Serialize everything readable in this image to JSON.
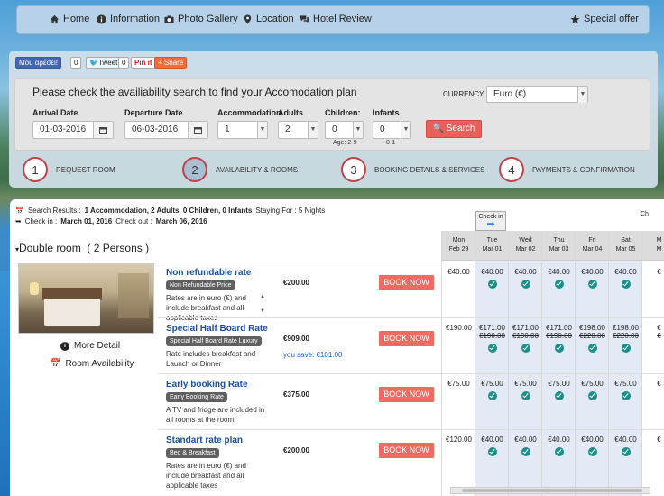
{
  "nav": {
    "home": "Home",
    "information": "Information",
    "photo_gallery": "Photo Gallery",
    "location": "Location",
    "hotel_review": "Hotel Review",
    "special_offer": "Special offer"
  },
  "social": {
    "facebook": "Μου αρέσει!",
    "facebook_count": "0",
    "tweet": "Tweet",
    "tweet_count": "0",
    "pinit": "Pin it",
    "share": "Share"
  },
  "search": {
    "title": "Please check the availiability search to find your Accomodation plan",
    "currency_label": "CURRENCY :",
    "currency_value": "Euro (€)",
    "arrival_label": "Arrival Date",
    "arrival_value": "01-03-2016",
    "departure_label": "Departure Date",
    "departure_value": "06-03-2016",
    "accommodation_label": "Accommodation",
    "accommodation_value": "1",
    "adults_label": "Adults",
    "adults_value": "2",
    "children_label": "Children:",
    "children_value": "0",
    "children_hint": "Age: 2-9",
    "infants_label": "Infants",
    "infants_value": "0",
    "infants_hint": "0-1",
    "search_button": "Search"
  },
  "steps": [
    {
      "num": "1",
      "label": "REQUEST ROOM"
    },
    {
      "num": "2",
      "label": "AVAILABILITY & ROOMS"
    },
    {
      "num": "3",
      "label": "BOOKING DETAILS & SERVICES"
    },
    {
      "num": "4",
      "label": "PAYMENTS & CONFIRMATION"
    }
  ],
  "results": {
    "prefix": "Search Results :",
    "summary": "1 Accommodation, 2 Adults, 0 Children, 0 Infants",
    "staying": "Staying For : 5 Nights",
    "checkin_text": "Check in : ",
    "checkin_date": "March 01, 2016",
    "checkout_text": " Check out : ",
    "checkout_date": "March 06, 2016",
    "checkin_tag": "Check in",
    "partial_tag": "Ch"
  },
  "room": {
    "title": "Double room",
    "persons": "( 2 Persons )",
    "more_detail": "More Detail",
    "room_availability": "Room Availability"
  },
  "days": [
    {
      "d": "Mon",
      "date": "Feb 29"
    },
    {
      "d": "Tue",
      "date": "Mar 01"
    },
    {
      "d": "Wed",
      "date": "Mar 02"
    },
    {
      "d": "Thu",
      "date": "Mar 03"
    },
    {
      "d": "Fri",
      "date": "Mar 04"
    },
    {
      "d": "Sat",
      "date": "Mar 05"
    },
    {
      "d": "M",
      "date": "M"
    }
  ],
  "rates": [
    {
      "name": "Non refundable rate",
      "tag": "Non Refundable Price",
      "desc": "Rates are in euro (€) and include breakfast and all applicable taxes",
      "price": "€200.00",
      "save": "",
      "book": "BOOK NOW",
      "prices": [
        "€40.00",
        "€40.00",
        "€40.00",
        "€40.00",
        "€40.00",
        "€40.00",
        "€"
      ],
      "old": [
        "",
        "",
        "",
        "",
        "",
        "",
        ""
      ]
    },
    {
      "name": "Special Half Board Rate",
      "tag": "Special Half Board Rate Luxury",
      "desc": "Rate includes breakfast and Launch or Dinner",
      "price": "€909.00",
      "save": "you save: €101.00",
      "book": "BOOK NOW",
      "prices": [
        "€190.00",
        "€171.00",
        "€171.00",
        "€171.00",
        "€198.00",
        "€198.00",
        "€"
      ],
      "old": [
        "",
        "€190.00",
        "€190.00",
        "€190.00",
        "€220.00",
        "€220.00",
        "€"
      ]
    },
    {
      "name": "Early booking Rate",
      "tag": "Early Booking Rate",
      "desc": "A TV and fridge are included in all rooms at the room.",
      "price": "€375.00",
      "save": "",
      "book": "BOOK NOW",
      "prices": [
        "€75.00",
        "€75.00",
        "€75.00",
        "€75.00",
        "€75.00",
        "€75.00",
        "€"
      ],
      "old": [
        "",
        "",
        "",
        "",
        "",
        "",
        ""
      ]
    },
    {
      "name": "Standart rate plan",
      "tag": "Bed & Breakfast",
      "desc": "Rates are in euro (€) and include breakfast and all applicable taxes",
      "price": "€200.00",
      "save": "",
      "book": "BOOK NOW",
      "prices": [
        "€120.00",
        "€40.00",
        "€40.00",
        "€40.00",
        "€40.00",
        "€40.00",
        "€"
      ],
      "old": [
        "",
        "",
        "",
        "",
        "",
        "",
        ""
      ]
    }
  ]
}
